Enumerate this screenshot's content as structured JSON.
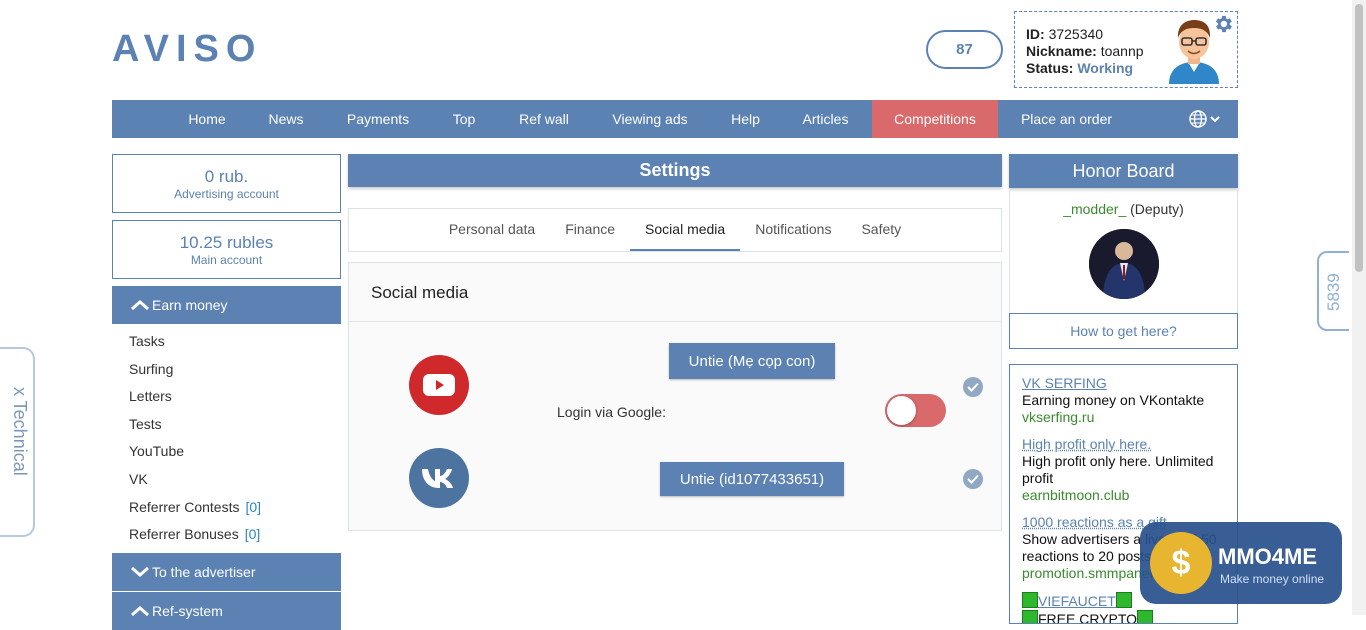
{
  "logo": "AVISO",
  "balance_badge": "87",
  "profile": {
    "id_label": "ID:",
    "id_value": "3725340",
    "nickname_label": "Nickname:",
    "nickname_value": "toannp",
    "status_label": "Status:",
    "status_value": "Working"
  },
  "nav": {
    "items": [
      "Home",
      "News",
      "Payments",
      "Top",
      "Ref wall",
      "Viewing ads",
      "Help",
      "Articles",
      "Competitions",
      "Place an order"
    ],
    "active": "Competitions"
  },
  "accounts": [
    {
      "amount": "0 rub.",
      "label": "Advertising account"
    },
    {
      "amount": "10.25 rubles",
      "label": "Main account"
    }
  ],
  "earn_money": {
    "title": "Earn money",
    "items": [
      "Tasks",
      "Surfing",
      "Letters",
      "Tests",
      "YouTube",
      "VK",
      "Referrer Contests",
      "Referrer Bonuses"
    ],
    "referrer_contests_count": "[0]",
    "referrer_bonuses_count": "[0]"
  },
  "to_advertiser": {
    "title": "To the advertiser"
  },
  "ref_system": {
    "title": "Ref-system"
  },
  "settings": {
    "title": "Settings",
    "tabs": [
      "Personal data",
      "Finance",
      "Social media",
      "Notifications",
      "Safety"
    ],
    "active_tab": "Social media",
    "panel_title": "Social media",
    "youtube_button": "Untie (Mẹ cọp con)",
    "google_login_label": "Login via Google:",
    "vk_button": "Untie (id1077433651)"
  },
  "honor_board": {
    "title": "Honor Board",
    "name": "_modder_",
    "role": "(Deputy)",
    "how_to": "How to get here?"
  },
  "ads": [
    {
      "title": "VK SERFING",
      "desc": "Earning money on VKontakte",
      "url": "vkserfing.ru"
    },
    {
      "title": "High profit only here.",
      "desc": "High profit only here. Unlimited profit",
      "url": "earnbitmoon.club"
    },
    {
      "title": "1000 reactions as a gift",
      "desc": "Show advertisers a live feed 50 reactions to 20 posts",
      "url": "promotion.smmpanel.ru"
    },
    {
      "title": "VIEFAUCET",
      "desc": "FREE CRYPTO",
      "url": ""
    }
  ],
  "side_tab_right": "5839",
  "side_tab_left": "x Technical",
  "watermark": {
    "title": "MMO4ME",
    "subtitle": "Make money online"
  },
  "colors": {
    "primary": "#5b82b3",
    "active": "#d9696b",
    "link_green": "#3a8a2e"
  }
}
